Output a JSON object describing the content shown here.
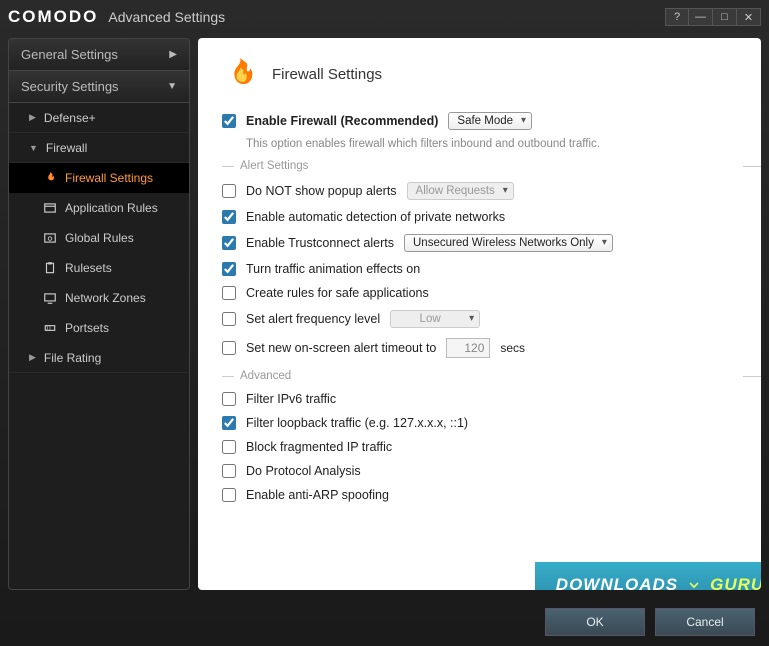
{
  "window": {
    "brand": "COMODO",
    "title": "Advanced Settings"
  },
  "sidebar": {
    "general": "General Settings",
    "security": "Security Settings",
    "items": {
      "defense": "Defense+",
      "firewall": "Firewall",
      "filerating": "File Rating"
    },
    "firewall_children": [
      "Firewall Settings",
      "Application Rules",
      "Global Rules",
      "Rulesets",
      "Network Zones",
      "Portsets"
    ]
  },
  "page": {
    "title": "Firewall Settings",
    "enable": {
      "label": "Enable Firewall (Recommended)",
      "checked": true,
      "mode": "Safe Mode"
    },
    "enable_desc": "This option enables firewall which filters inbound and outbound traffic.",
    "sections": {
      "alert": "Alert Settings",
      "advanced": "Advanced"
    },
    "alerts": {
      "no_popup": {
        "label": "Do NOT show popup alerts",
        "checked": false,
        "dd": "Allow Requests"
      },
      "auto_private": {
        "label": "Enable automatic detection of private networks",
        "checked": true
      },
      "trustconnect": {
        "label": "Enable Trustconnect alerts",
        "checked": true,
        "dd": "Unsecured Wireless Networks Only"
      },
      "animation": {
        "label": "Turn traffic animation effects on",
        "checked": true
      },
      "safe_rules": {
        "label": "Create rules for safe applications",
        "checked": false
      },
      "freq": {
        "label": "Set alert frequency level",
        "checked": false,
        "dd": "Low"
      },
      "timeout": {
        "label": "Set new on-screen alert timeout to",
        "checked": false,
        "value": "120",
        "unit": "secs"
      }
    },
    "advanced": {
      "ipv6": {
        "label": "Filter IPv6 traffic",
        "checked": false
      },
      "loopback": {
        "label": "Filter loopback traffic (e.g. 127.x.x.x, ::1)",
        "checked": true
      },
      "fragmented": {
        "label": "Block fragmented IP traffic",
        "checked": false
      },
      "protocol": {
        "label": "Do Protocol Analysis",
        "checked": false
      },
      "antiarp": {
        "label": "Enable anti-ARP spoofing",
        "checked": false
      }
    }
  },
  "footer": {
    "ok": "OK",
    "cancel": "Cancel"
  },
  "watermark": {
    "a": "DOWNLOADS",
    "b": "GURU"
  }
}
